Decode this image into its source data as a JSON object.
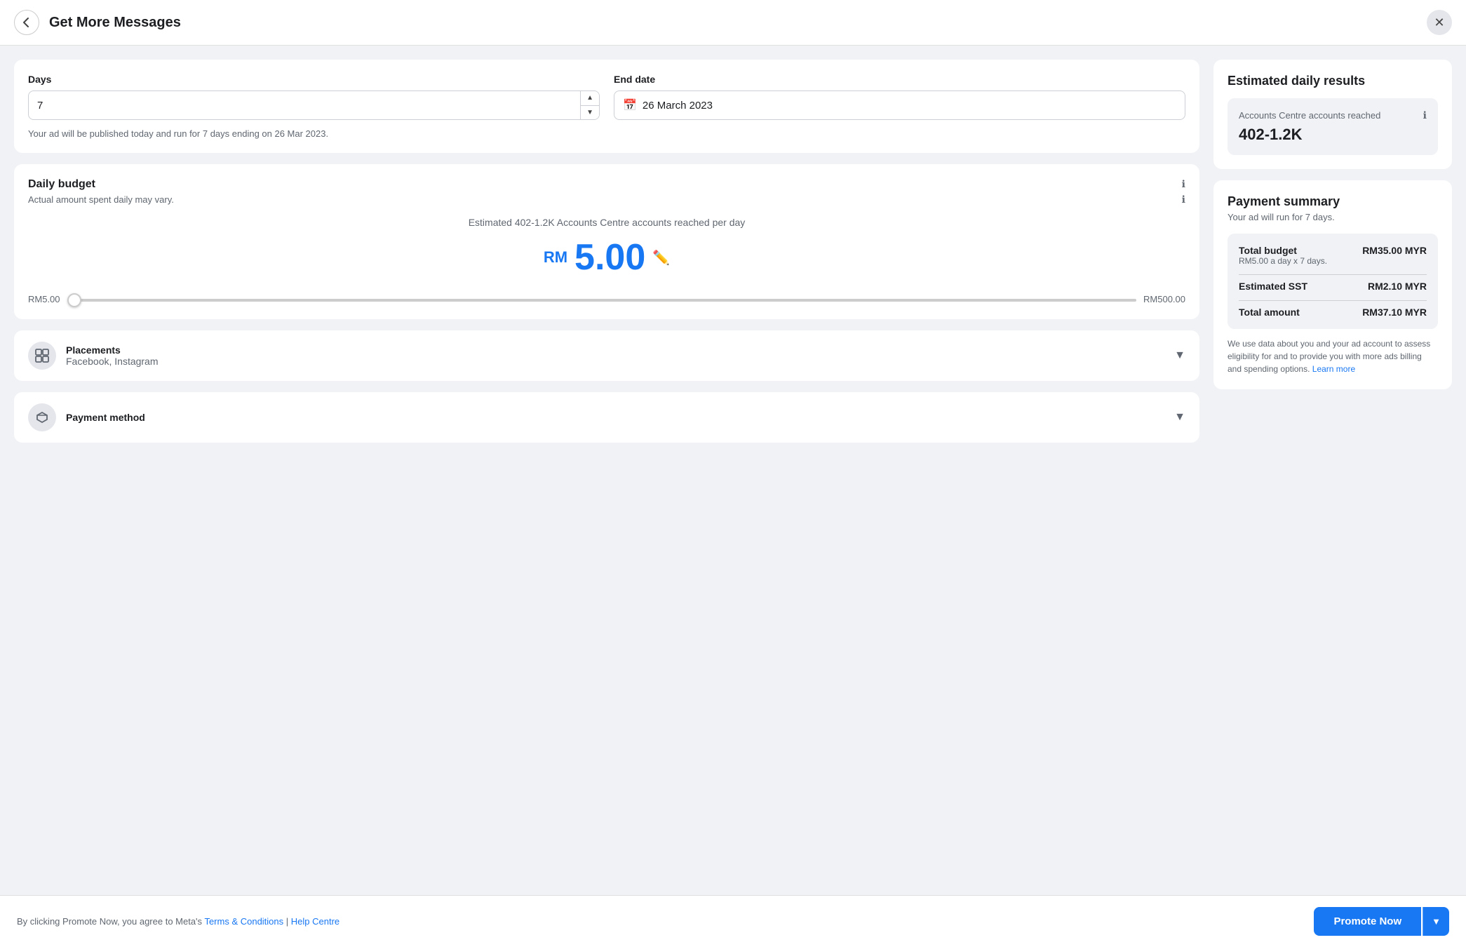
{
  "header": {
    "title": "Get More Messages",
    "back_label": "←",
    "close_label": "✕"
  },
  "duration": {
    "days_label": "Days",
    "days_value": "7",
    "end_date_label": "End date",
    "end_date_value": "26 March 2023",
    "ad_run_note": "Your ad will be published today and run for 7 days ending on 26 Mar 2023."
  },
  "budget": {
    "title": "Daily budget",
    "subtitle": "Actual amount spent daily may vary.",
    "estimated_reach_text": "Estimated 402-1.2K Accounts Centre accounts reached per day",
    "currency": "RM",
    "amount": "5.00",
    "slider_min": "RM5.00",
    "slider_max": "RM500.00"
  },
  "placements": {
    "label": "Placements",
    "value": "Facebook, Instagram"
  },
  "payment_method": {
    "label": "Payment method"
  },
  "estimated_results": {
    "title": "Estimated daily results",
    "reach_label": "Accounts Centre accounts reached",
    "reach_value": "402-1.2K"
  },
  "payment_summary": {
    "title": "Payment summary",
    "subtitle": "Your ad will run for 7 days.",
    "total_budget_label": "Total budget",
    "total_budget_sublabel": "RM5.00 a day x 7 days.",
    "total_budget_value": "RM35.00 MYR",
    "sst_label": "Estimated SST",
    "sst_value": "RM2.10 MYR",
    "total_amount_label": "Total amount",
    "total_amount_value": "RM37.10 MYR",
    "billing_note": "We use data about you and your ad account to assess eligibility for and to provide you with more ads billing and spending options.",
    "learn_more": "Learn more"
  },
  "footer": {
    "note": "By clicking Promote Now, you agree to Meta's",
    "terms_label": "Terms & Conditions",
    "separator": "|",
    "help_label": "Help Centre",
    "promote_btn_label": "Promote Now",
    "dropdown_icon": "▼"
  }
}
